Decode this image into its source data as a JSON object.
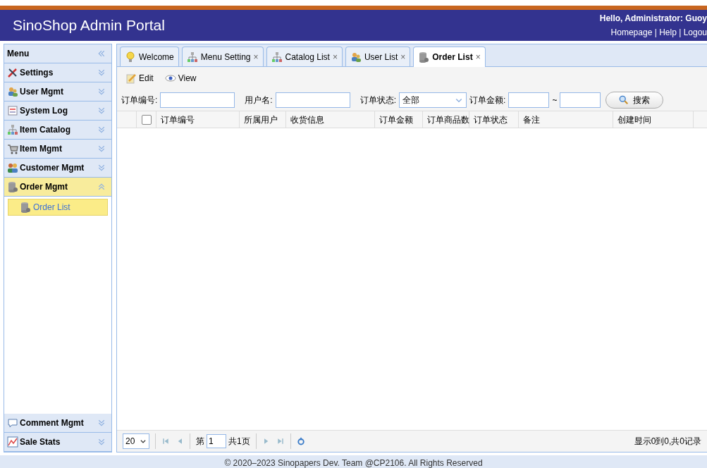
{
  "header": {
    "title": "SinoShop Admin Portal",
    "greeting": "Hello, Administrator: Guoy",
    "links": [
      "Homepage",
      "Help",
      "Logou"
    ],
    "separators": [
      "|",
      "|"
    ]
  },
  "sidebar": {
    "title": "Menu",
    "sections": [
      {
        "label": "Settings",
        "expanded": false
      },
      {
        "label": "User Mgmt",
        "expanded": false
      },
      {
        "label": "System Log",
        "expanded": false
      },
      {
        "label": "Item Catalog",
        "expanded": false
      },
      {
        "label": "Item Mgmt",
        "expanded": false
      },
      {
        "label": "Customer Mgmt",
        "expanded": false
      },
      {
        "label": "Order Mgmt",
        "expanded": true,
        "children": [
          {
            "label": "Order List",
            "selected": true
          }
        ]
      },
      {
        "label": "Comment Mgmt",
        "expanded": false
      },
      {
        "label": "Sale Stats",
        "expanded": false
      }
    ]
  },
  "tabs": [
    {
      "label": "Welcome",
      "selected": false,
      "closable": false
    },
    {
      "label": "Menu Setting",
      "selected": false,
      "closable": true
    },
    {
      "label": "Catalog List",
      "selected": false,
      "closable": true
    },
    {
      "label": "User List",
      "selected": false,
      "closable": true
    },
    {
      "label": "Order List",
      "selected": true,
      "closable": true
    }
  ],
  "close_mark": "×",
  "toolbar": [
    "Edit",
    "View"
  ],
  "filters": {
    "order_no": "订单编号:",
    "user": "用户名:",
    "status_label": "订单状态:",
    "status_value": "全部",
    "amount": "订单金额:",
    "range_sep": "~",
    "search": "搜索"
  },
  "table": {
    "select_all_checked": false,
    "columns": [
      "订单编号",
      "所属用户",
      "收货信息",
      "订单金额",
      "订单商品数",
      "订单状态",
      "备注",
      "创建时间"
    ]
  },
  "pager": {
    "page_size": "20",
    "page_prefix": "第",
    "page": "1",
    "page_suffix": "共1页",
    "summary": "显示0到0,共0记录"
  },
  "footer": "© 2020–2023 Sinopapers Dev. Team @CP2106. All Rights Reserved"
}
